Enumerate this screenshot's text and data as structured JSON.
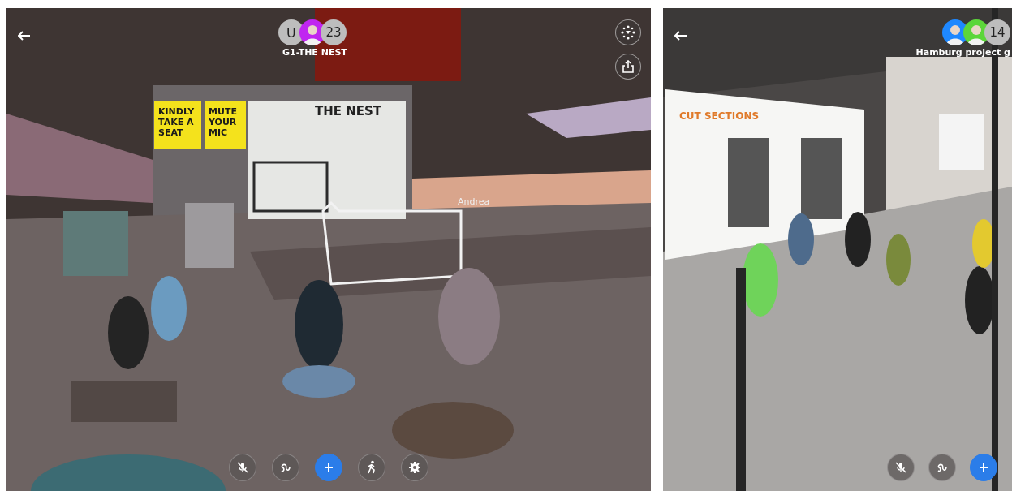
{
  "panels": [
    {
      "title": "G1-THE NEST",
      "kind": "auditorium",
      "avatars": [
        {
          "kind": "letter",
          "text": "U"
        },
        {
          "kind": "person",
          "color": "#c026f0"
        },
        {
          "kind": "count",
          "text": "23"
        }
      ],
      "top_actions": [
        {
          "kind": "recenter"
        },
        {
          "kind": "share"
        }
      ],
      "signs": [
        {
          "kind": "yellow",
          "text": "KINDLY TAKE A SEAT"
        },
        {
          "kind": "yellow",
          "text": "MUTE YOUR MIC"
        },
        {
          "kind": "board",
          "text": "THE NEST"
        },
        {
          "kind": "nametag",
          "text": "Andrea"
        }
      ],
      "controls": [
        {
          "kind": "mic-off"
        },
        {
          "kind": "draw"
        },
        {
          "kind": "add"
        },
        {
          "kind": "walk"
        },
        {
          "kind": "settings"
        }
      ]
    },
    {
      "title": "Hamburg project g",
      "kind": "gallery",
      "avatars": [
        {
          "kind": "person",
          "color": "#1e88ff"
        },
        {
          "kind": "person",
          "color": "#5cd63a"
        },
        {
          "kind": "count",
          "text": "14"
        }
      ],
      "signs": [
        {
          "kind": "board",
          "text": "CUT SECTIONS"
        }
      ],
      "controls": [
        {
          "kind": "mic-off"
        },
        {
          "kind": "draw"
        },
        {
          "kind": "add"
        }
      ]
    }
  ]
}
